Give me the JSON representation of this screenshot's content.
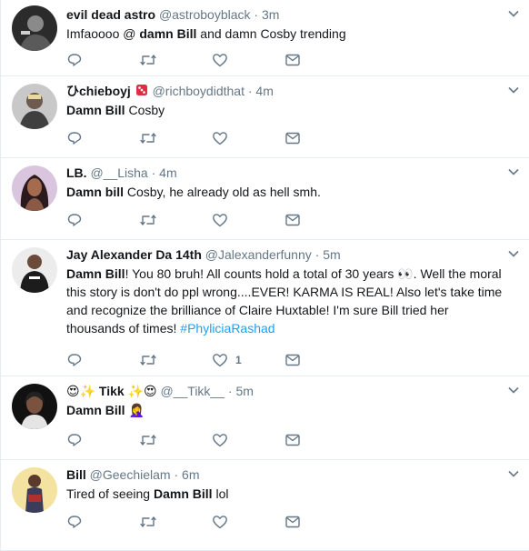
{
  "tweets": [
    {
      "name": "evil dead astro",
      "handle": "@astroboyblack",
      "time": "3m",
      "segments": [
        [
          "Imfaoooo @ ",
          false
        ],
        [
          "damn Bill",
          true
        ],
        [
          " and damn Cosby trending",
          false
        ]
      ],
      "likes": "",
      "avatar": "dark"
    },
    {
      "name": "ひchieboyj",
      "handle": "@richboydidthat",
      "time": "4m",
      "badge": "die-icon",
      "segments": [
        [
          "Damn Bill",
          true
        ],
        [
          " Cosby",
          false
        ]
      ],
      "likes": "",
      "avatar": "gray"
    },
    {
      "name": "LB.",
      "handle": "@__Lisha",
      "time": "4m",
      "segments": [
        [
          "Damn bill",
          true
        ],
        [
          " Cosby, he already old as hell smh.",
          false
        ]
      ],
      "likes": "",
      "avatar": "purple"
    },
    {
      "name": "Jay Alexander Da 14th",
      "handle": "@Jalexanderfunny",
      "time": "5m",
      "segments": [
        [
          "Damn Bill",
          true
        ],
        [
          "! You 80 bruh! All counts hold a total of 30 years 👀. Well the moral this story is don't do ppl wrong....EVER! KARMA IS REAL! Also let's take time and recognize the brilliance of Claire Huxtable! I'm sure Bill tried her thousands of times! ",
          false
        ]
      ],
      "hashtag": "#PhyliciaRashad",
      "likes": "1",
      "avatar": "light"
    },
    {
      "name": "Tikk",
      "handle": "@__Tikk__",
      "time": "5m",
      "name_prefix": "😍✨",
      "name_suffix": "✨😍",
      "segments": [
        [
          "Damn Bill",
          true
        ],
        [
          " 🤦‍♀️",
          false
        ]
      ],
      "likes": "",
      "avatar": "black"
    },
    {
      "name": "Bill",
      "handle": "@Geechielam",
      "time": "6m",
      "segments": [
        [
          "Tired of seeing ",
          false
        ],
        [
          "Damn Bill",
          true
        ],
        [
          " lol",
          false
        ]
      ],
      "likes": "",
      "avatar": "yellow"
    }
  ],
  "colors": {
    "text": "#14171a",
    "muted": "#657786",
    "link": "#1da1f2",
    "divider": "#e6ecf0"
  },
  "icons": [
    "reply-icon",
    "retweet-icon",
    "like-icon",
    "message-icon",
    "chevron-down-icon"
  ]
}
